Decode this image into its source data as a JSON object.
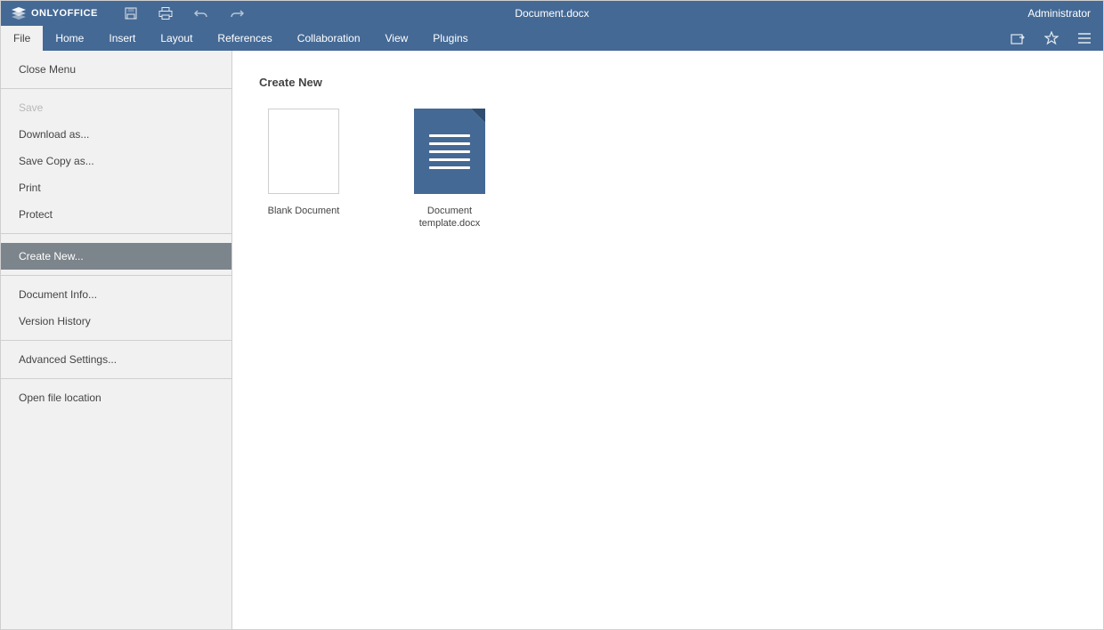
{
  "brand": "ONLYOFFICE",
  "document_title": "Document.docx",
  "user_name": "Administrator",
  "menu_tabs": {
    "file": "File",
    "home": "Home",
    "insert": "Insert",
    "layout": "Layout",
    "references": "References",
    "collaboration": "Collaboration",
    "view": "View",
    "plugins": "Plugins"
  },
  "sidebar": {
    "close_menu": "Close Menu",
    "save": "Save",
    "download_as": "Download as...",
    "save_copy_as": "Save Copy as...",
    "print": "Print",
    "protect": "Protect",
    "create_new": "Create New...",
    "document_info": "Document Info...",
    "version_history": "Version History",
    "advanced_settings": "Advanced Settings...",
    "open_file_location": "Open file location"
  },
  "main": {
    "heading": "Create New",
    "templates": {
      "blank": "Blank Document",
      "doc_template": "Document template.docx"
    }
  },
  "icons": {
    "logo": "onlyoffice-logo-icon",
    "save": "save-icon",
    "print": "print-icon",
    "undo": "undo-icon",
    "redo": "redo-icon",
    "open_location": "open-location-icon",
    "favorite": "star-icon",
    "more": "hamburger-icon"
  },
  "colors": {
    "brand_bg": "#446995",
    "panel_bg": "#f1f1f1",
    "selected_bg": "#7d858c"
  }
}
